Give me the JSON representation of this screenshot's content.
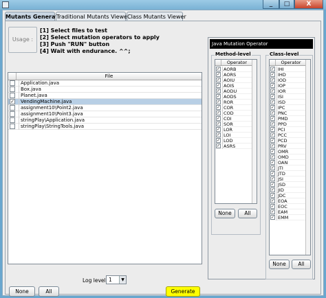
{
  "window": {
    "min_label": "_",
    "max_label": "□",
    "close_label": "X"
  },
  "tabs": [
    {
      "label": "Mutants Generator",
      "active": true
    },
    {
      "label": "Traditional Mutants Viewer",
      "active": false
    },
    {
      "label": "Class Mutants Viewer",
      "active": false
    }
  ],
  "usage": {
    "button_label": "Usage :",
    "instructions": [
      "[1] Select files to test",
      "[2] Select mutation operators to apply",
      "[3] Push \"RUN\" button",
      "[4] Wait with endurance. ^^;"
    ]
  },
  "file_table": {
    "header": "File",
    "files": [
      {
        "name": "Application.java",
        "checked": false,
        "selected": false
      },
      {
        "name": "Box.java",
        "checked": false,
        "selected": false
      },
      {
        "name": "Planet.java",
        "checked": false,
        "selected": false
      },
      {
        "name": "VendingMachine.java",
        "checked": true,
        "selected": true
      },
      {
        "name": "assignment10\\Point2.java",
        "checked": false,
        "selected": false
      },
      {
        "name": "assignment10\\Point3.java",
        "checked": false,
        "selected": false
      },
      {
        "name": "stringPlay\\Application.java",
        "checked": false,
        "selected": false
      },
      {
        "name": "stringPlay\\StringTools.java",
        "checked": false,
        "selected": false
      }
    ]
  },
  "log_level": {
    "label": "Log level",
    "value": "1",
    "arrow": "▼"
  },
  "bottom_buttons": {
    "none": "None",
    "all": "All",
    "generate": "Generate"
  },
  "operator_panel": {
    "title": "Java Mutation Operator",
    "method_level": {
      "label": "Method-level",
      "header": "Operator",
      "operators": [
        "AORB",
        "AORS",
        "AOIU",
        "AOIS",
        "AODU",
        "AODS",
        "ROR",
        "COR",
        "COD",
        "COI",
        "SOR",
        "LOR",
        "LOI",
        "LOD",
        "ASRS"
      ],
      "none": "None",
      "all": "All"
    },
    "class_level": {
      "label": "Class-level",
      "header": "Operator",
      "operators": [
        "IHI",
        "IHD",
        "IOD",
        "IOP",
        "IOR",
        "ISI",
        "ISD",
        "IPC",
        "PNC",
        "PMD",
        "PPD",
        "PCI",
        "PCC",
        "PCD",
        "PRV",
        "OMR",
        "OMD",
        "OAN",
        "JTI",
        "JTD",
        "JSI",
        "JSD",
        "JID",
        "JDC",
        "EOA",
        "EOC",
        "EAM",
        "EMM"
      ],
      "none": "None",
      "all": "All"
    },
    "check_mark": "✓"
  },
  "colors": {
    "generate_bg": "#ffff00",
    "selected_row": "#b8cfe5",
    "title_bg": "#000000"
  }
}
